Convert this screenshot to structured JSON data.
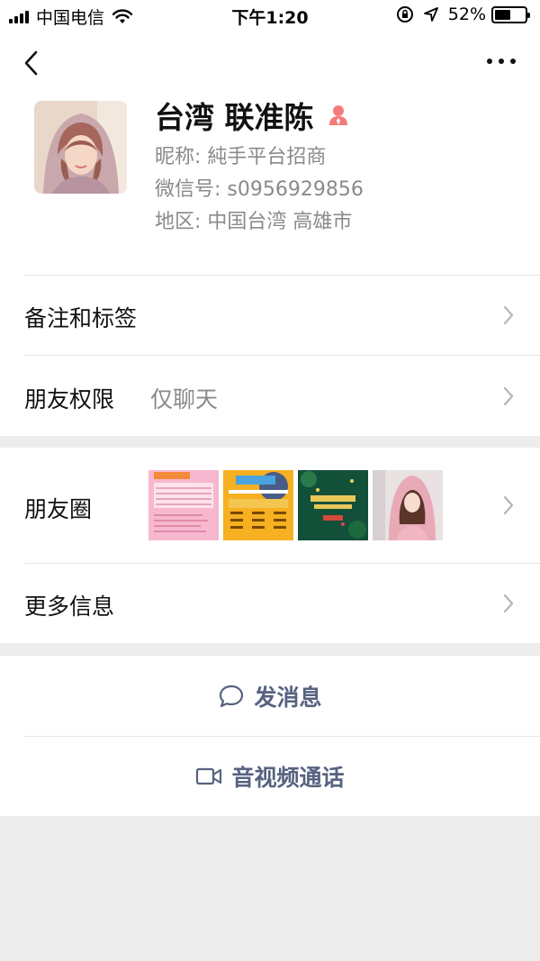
{
  "status_bar": {
    "carrier": "中国电信",
    "time": "下午1:20",
    "battery_percent": "52%",
    "battery_level": 0.52
  },
  "profile": {
    "name": "台湾 联准陈",
    "nickname": "昵称:  純手平台招商",
    "wechat_id": "微信号:  s0956929856",
    "region": "地区:  中国台湾 高雄市"
  },
  "rows": {
    "remark_label": "备注和标签",
    "permission_label": "朋友权限",
    "permission_value": "仅聊天",
    "moments_label": "朋友圈",
    "more_info_label": "更多信息"
  },
  "moments_thumbs": [
    {
      "name": "moments-thumb-pink-flyer",
      "color": "#f6a9c4"
    },
    {
      "name": "moments-thumb-yellow-flyer",
      "color": "#f6b021"
    },
    {
      "name": "moments-thumb-green-flyer",
      "color": "#13503a"
    },
    {
      "name": "moments-thumb-photo",
      "color": "#e7b7bd"
    }
  ],
  "actions": {
    "send_message": "发消息",
    "video_call": "音视频通话"
  },
  "colors": {
    "link_blue": "#56627f",
    "gender_icon": "#f37b7b",
    "secondary_text": "#8a8a8a",
    "background": "#ededed"
  },
  "icons": [
    "signal-bars-icon",
    "wifi-icon",
    "lock-rotation-icon",
    "location-arrow-icon",
    "battery-icon",
    "back-arrow-icon",
    "more-dots-icon",
    "gender-female-icon",
    "chevron-right-icon",
    "chat-bubble-icon",
    "video-camera-icon"
  ]
}
